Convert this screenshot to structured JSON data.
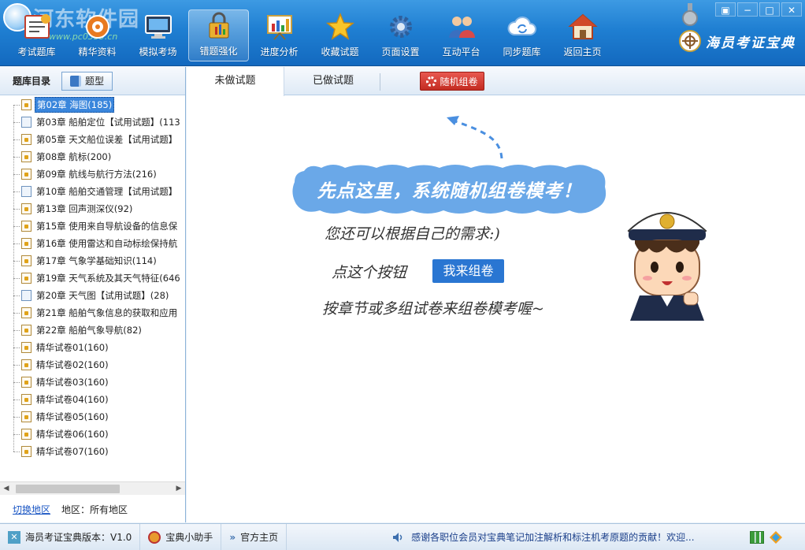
{
  "watermark": {
    "text": "河东软件园",
    "sub": "www.pc0359.cn"
  },
  "toolbar": {
    "items": [
      {
        "label": "考试题库",
        "icon": "exam-bank-icon"
      },
      {
        "label": "精华资料",
        "icon": "materials-icon"
      },
      {
        "label": "模拟考场",
        "icon": "mock-exam-icon"
      },
      {
        "label": "错题强化",
        "icon": "wrong-questions-icon",
        "active": true
      },
      {
        "label": "进度分析",
        "icon": "progress-chart-icon"
      },
      {
        "label": "收藏试题",
        "icon": "star-icon"
      },
      {
        "label": "页面设置",
        "icon": "gear-icon"
      },
      {
        "label": "互动平台",
        "icon": "users-icon"
      },
      {
        "label": "同步题库",
        "icon": "sync-cloud-icon"
      },
      {
        "label": "返回主页",
        "icon": "home-icon"
      }
    ]
  },
  "window": {
    "restore": "▣",
    "minimize": "−",
    "maximize": "□",
    "close": "✕"
  },
  "brand": {
    "name": "海员考证宝典"
  },
  "left": {
    "title": "题库目录",
    "type_button": "题型",
    "tree": [
      {
        "label": "第02章 海图(185)",
        "icon": "lock",
        "selected": true
      },
      {
        "label": "第03章 船舶定位【试用试题】(113",
        "icon": "plain"
      },
      {
        "label": "第05章 天文船位误差【试用试题】",
        "icon": "lock"
      },
      {
        "label": "第08章 航标(200)",
        "icon": "lock"
      },
      {
        "label": "第09章 航线与航行方法(216)",
        "icon": "lock"
      },
      {
        "label": "第10章 船舶交通管理【试用试题】",
        "icon": "plain"
      },
      {
        "label": "第13章 回声测深仪(92)",
        "icon": "lock"
      },
      {
        "label": "第15章 使用来自导航设备的信息保",
        "icon": "lock"
      },
      {
        "label": "第16章 使用雷达和自动标绘保持航",
        "icon": "lock"
      },
      {
        "label": "第17章 气象学基础知识(114)",
        "icon": "lock"
      },
      {
        "label": "第19章 天气系统及其天气特征(646",
        "icon": "lock"
      },
      {
        "label": "第20章 天气图【试用试题】(28)",
        "icon": "plain"
      },
      {
        "label": "第21章 船舶气象信息的获取和应用",
        "icon": "lock"
      },
      {
        "label": "第22章 船舶气象导航(82)",
        "icon": "lock"
      },
      {
        "label": "精华试卷01(160)",
        "icon": "lock"
      },
      {
        "label": "精华试卷02(160)",
        "icon": "lock"
      },
      {
        "label": "精华试卷03(160)",
        "icon": "lock"
      },
      {
        "label": "精华试卷04(160)",
        "icon": "lock"
      },
      {
        "label": "精华试卷05(160)",
        "icon": "lock"
      },
      {
        "label": "精华试卷06(160)",
        "icon": "lock"
      },
      {
        "label": "精华试卷07(160)",
        "icon": "lock"
      }
    ],
    "switch_region": "切换地区",
    "region": "地区：所有地区"
  },
  "main": {
    "tabs": [
      {
        "label": "未做试题",
        "active": true
      },
      {
        "label": "已做试题",
        "active": false
      }
    ],
    "random_button": "随机组卷",
    "cloud_text": "先点这里，系统随机组卷模考！",
    "line2": "您还可以根据自己的需求:)",
    "line3": "点这个按钮",
    "zujuan_button": "我来组卷",
    "line4": "按章节或多组试卷来组卷模考喔~"
  },
  "status": {
    "version": "海员考证宝典版本：V1.0",
    "helper": "宝典小助手",
    "homepage": "官方主页",
    "marquee": "感谢各职位会员对宝典笔记加注解析和标注机考原题的贡献！欢迎..."
  },
  "colors": {
    "toolbar": "#1f7fd2",
    "accent": "#2a76d2",
    "random_button": "#c32c22",
    "cloud": "#6aa8e8"
  }
}
